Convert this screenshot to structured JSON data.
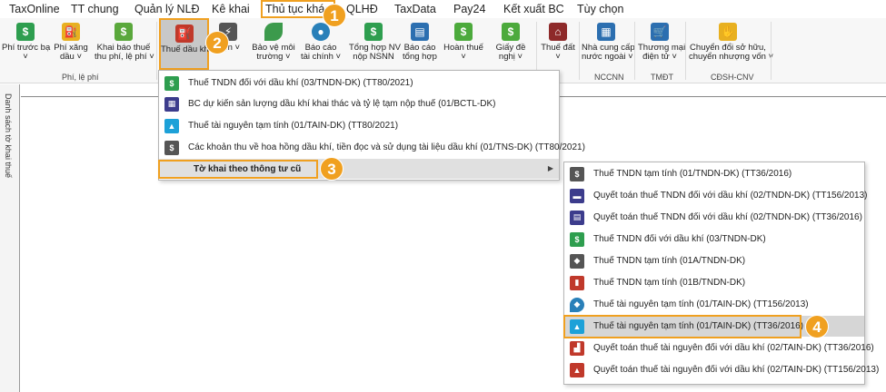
{
  "menubar": [
    {
      "label": "TaxOnline"
    },
    {
      "label": "TT chung"
    },
    {
      "label": "Quản lý NLĐ"
    },
    {
      "label": "Kê khai"
    },
    {
      "label": "Thủ tục khác"
    },
    {
      "label": "QLHĐ"
    },
    {
      "label": "TaxData"
    },
    {
      "label": "Pay24"
    },
    {
      "label": "Kết xuất BC"
    },
    {
      "label": "Tùy chọn"
    }
  ],
  "ribbon": {
    "buttons": [
      {
        "l1": "Phí trước bạ",
        "l2": "˅"
      },
      {
        "l1": "Phí xăng",
        "l2": "dầu ˅"
      },
      {
        "l1": "Khai báo thuế",
        "l2": "thu phí, lệ phí ˅"
      },
      {
        "l1": "Thuế dầu khí",
        "l2": ""
      },
      {
        "l1": "",
        "l2": "điện ˅"
      },
      {
        "l1": "Bảo vệ môi",
        "l2": "trường ˅"
      },
      {
        "l1": "Báo cáo",
        "l2": "tài chính ˅"
      },
      {
        "l1": "Tổng hợp NV",
        "l2": "nộp NSNN"
      },
      {
        "l1": "Báo cáo",
        "l2": "tổng hợp"
      },
      {
        "l1": "Hoàn thuế",
        "l2": "˅"
      },
      {
        "l1": "Giấy đề",
        "l2": "nghị ˅"
      },
      {
        "l1": "Thuế đất",
        "l2": "˅"
      },
      {
        "l1": "Nhà cung cấp",
        "l2": "nước ngoài ˅"
      },
      {
        "l1": "Thương mại",
        "l2": "điện tử ˅"
      },
      {
        "l1": "Chuyển đổi sở hữu,",
        "l2": "chuyển nhượng vốn ˅"
      }
    ],
    "groups": [
      "Phí, lệ phí",
      "NCCNN",
      "TMĐT",
      "CĐSH-CNV"
    ]
  },
  "left_panel": {
    "vertical_label": "Danh sách tờ khai thuế"
  },
  "menu1": {
    "items": [
      {
        "label": "Thuế TNDN đối với dầu khí (03/TNDN-DK) (TT80/2021)"
      },
      {
        "label": "BC dự kiến sản lượng dầu khí  khai thác và tỷ lệ tạm nộp thuế (01/BCTL-DK)"
      },
      {
        "label": "Thuế tài nguyên tạm tính (01/TAIN-DK) (TT80/2021)"
      },
      {
        "label": "Các khoản thu về hoa hồng dầu khí, tiền đọc và sử dụng tài liệu dầu khí (01/TNS-DK) (TT80/2021)"
      },
      {
        "label": "Tờ khai theo thông tư cũ"
      }
    ]
  },
  "menu2": {
    "items": [
      {
        "label": "Thuế TNDN tạm tính (01/TNDN-DK) (TT36/2016)"
      },
      {
        "label": "Quyết toán thuế TNDN đối với dầu khí (02/TNDN-DK) (TT156/2013)"
      },
      {
        "label": "Quyết toán thuế TNDN đối với dầu khí (02/TNDN-DK) (TT36/2016)"
      },
      {
        "label": "Thuế TNDN đối với dầu khí (03/TNDN-DK)"
      },
      {
        "label": "Thuế TNDN tạm tính (01A/TNDN-DK)"
      },
      {
        "label": "Thuế TNDN tạm tính (01B/TNDN-DK)"
      },
      {
        "label": "Thuế tài nguyên tạm tính (01/TAIN-DK) (TT156/2013)"
      },
      {
        "label": "Thuế tài nguyên tạm tính (01/TAIN-DK) (TT36/2016)"
      },
      {
        "label": "Quyết toán thuế tài nguyên đối với dầu khí (02/TAIN-DK) (TT36/2016)"
      },
      {
        "label": "Quyết toán thuế tài nguyên đối với dầu khí (02/TAIN-DK) (TT156/2013)"
      }
    ]
  },
  "step_badges": [
    "1",
    "2",
    "3",
    "4"
  ],
  "colors": {
    "accent": "#f0a020",
    "selected_bg": "#c8c8c8"
  }
}
